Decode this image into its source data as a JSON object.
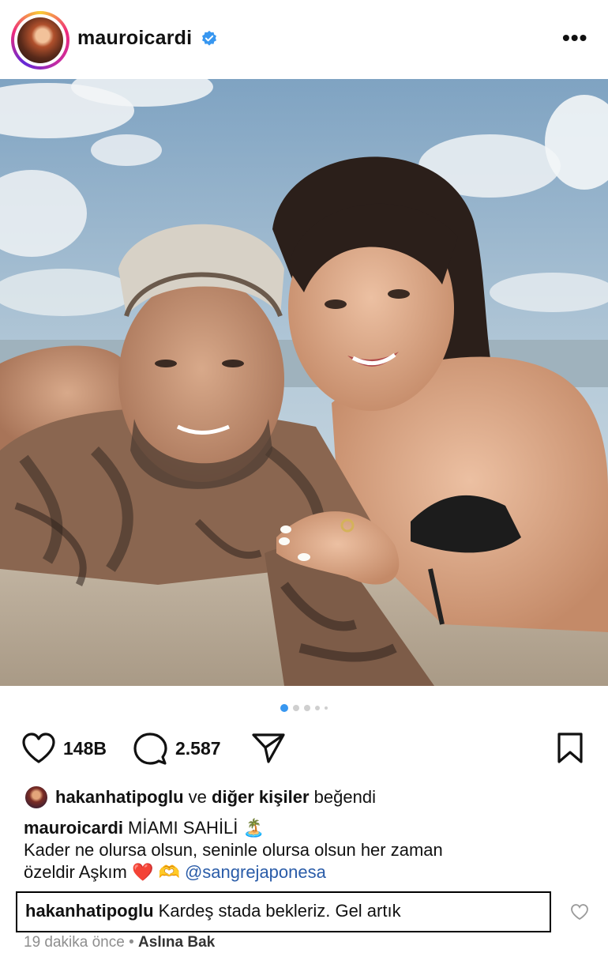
{
  "post": {
    "username": "mauroicardi",
    "more_label": "•••"
  },
  "carousel": {
    "total": 5,
    "active_index": 0
  },
  "actions": {
    "likes_count": "148B",
    "comments_count": "2.587"
  },
  "liked_by": {
    "user": "hakanhatipoglu",
    "connector": " ve ",
    "others": "diğer kişiler",
    "suffix": " beğendi"
  },
  "caption": {
    "author": "mauroicardi",
    "title": " MİAMI SAHİLİ ",
    "title_emoji": "🏝️",
    "line2": "Kader ne olursa olsun, seninle olursa olsun her zaman",
    "line3": "özeldir Aşkım ",
    "line3_emoji": "❤️ 🫶 ",
    "mention": "@sangrejaponesa"
  },
  "comment": {
    "author": "hakanhatipoglu",
    "text": " Kardeş stada bekleriz. Gel artık"
  },
  "meta": {
    "time": "19 dakika önce",
    "separator": " • ",
    "see_translation": "Aslına Bak"
  },
  "colors": {
    "verified": "#3897f0",
    "mention": "#2a5ca8",
    "heart_emoji": "#e0262f"
  }
}
